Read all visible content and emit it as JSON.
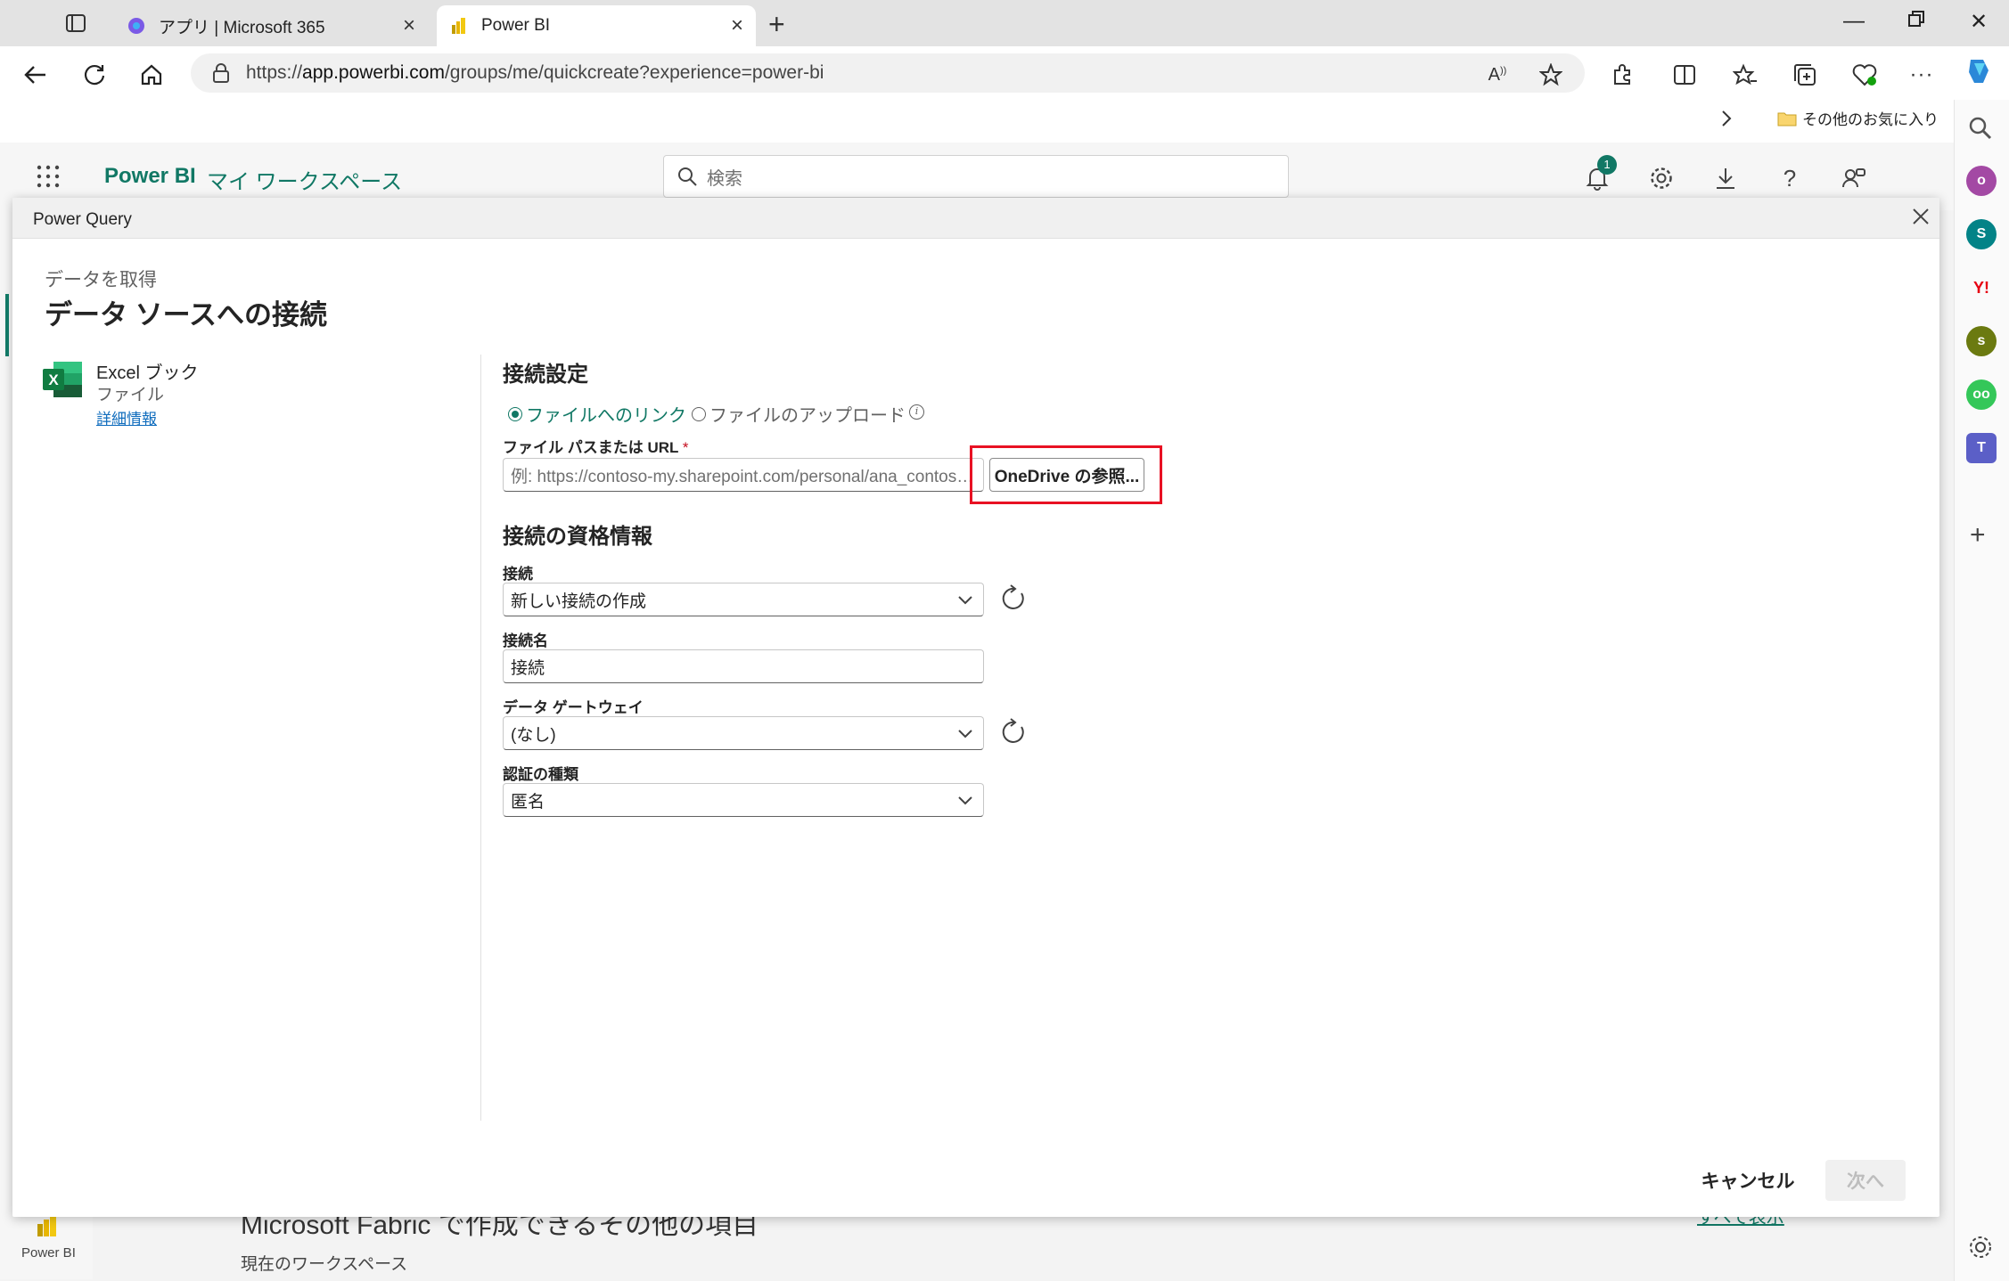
{
  "browser": {
    "tabs": [
      {
        "label": "アプリ | Microsoft 365",
        "icon": "microsoft365-icon"
      },
      {
        "label": "Power BI",
        "icon": "powerbi-icon"
      }
    ],
    "url_prefix": "https://",
    "url_host": "app.powerbi.com",
    "url_path": "/groups/me/quickcreate?experience=power-bi",
    "favorites_other": "その他のお気に入り"
  },
  "pbi": {
    "brand": "Power BI",
    "workspace": "マイ ワークスペース",
    "search_placeholder": "検索",
    "notification_count": "1",
    "left_nav_label": "Power BI",
    "bg_heading": "Microsoft Fabric で作成できるその他の項目",
    "bg_subtitle": "現在のワークスペース",
    "bg_link": "すべて表示"
  },
  "dialog": {
    "title": "Power Query",
    "breadcrumb": "データを取得",
    "heading": "データ ソースへの接続",
    "source": {
      "name": "Excel ブック",
      "category": "ファイル",
      "details_link": "詳細情報"
    },
    "connection_settings": {
      "title": "接続設定",
      "radio_link": "ファイルへのリンク",
      "radio_upload": "ファイルのアップロード",
      "path_label": "ファイル パスまたは URL",
      "required_mark": "*",
      "path_placeholder": "例: https://contoso-my.sharepoint.com/personal/ana_contoso_com/Documents/Book.xlsx",
      "browse_button": "OneDrive の参照..."
    },
    "credentials": {
      "title": "接続の資格情報",
      "connection_label": "接続",
      "connection_value": "新しい接続の作成",
      "name_label": "接続名",
      "name_value": "接続",
      "gateway_label": "データ ゲートウェイ",
      "gateway_value": "(なし)",
      "auth_label": "認証の種類",
      "auth_value": "匿名"
    },
    "cancel_button": "キャンセル",
    "next_button": "次へ"
  },
  "colors": {
    "accent": "#117865",
    "highlight": "#e81123",
    "link": "#0f6cbd"
  }
}
